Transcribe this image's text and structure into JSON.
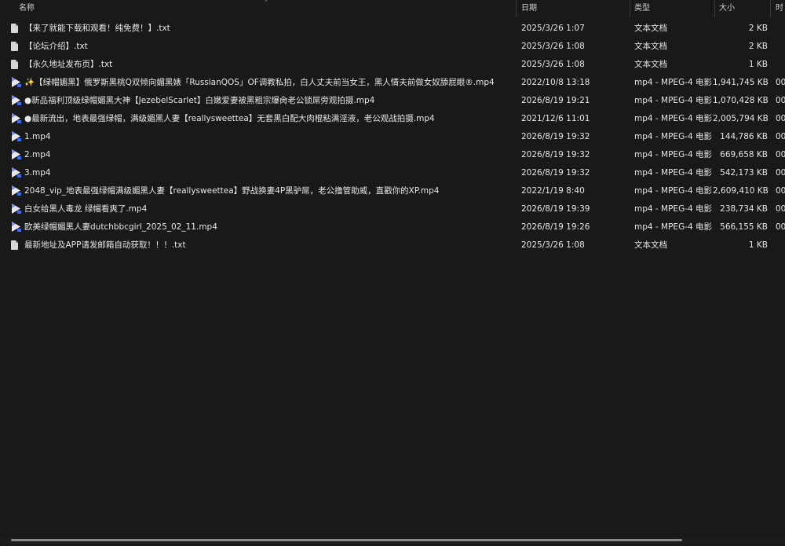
{
  "columns": {
    "name": "名称",
    "date": "日期",
    "type": "类型",
    "size": "大小",
    "extra": "时"
  },
  "files": [
    {
      "icon": "text-file-icon",
      "name": "【来了就能下载和观看！纯免费！】.txt",
      "date": "2025/3/26 1:07",
      "type": "文本文档",
      "size": "2 KB",
      "extra": ""
    },
    {
      "icon": "text-file-icon",
      "name": "【论坛介绍】.txt",
      "date": "2025/3/26 1:08",
      "type": "文本文档",
      "size": "2 KB",
      "extra": ""
    },
    {
      "icon": "text-file-icon",
      "name": "【永久地址发布页】.txt",
      "date": "2025/3/26 1:08",
      "type": "文本文档",
      "size": "1 KB",
      "extra": ""
    },
    {
      "icon": "video-file-icon",
      "name": "✨【绿帽媚黑】俄罗斯黑桃Q双倾向媚黑婊「RussianQOS」OF调教私拍，白人丈夫前当女王，黑人情夫前做女奴舔屁眼®.mp4",
      "date": "2022/10/8 13:18",
      "type": "mp4 - MPEG-4 电影...",
      "size": "1,941,745 KB",
      "extra": "00"
    },
    {
      "icon": "video-file-icon",
      "name": "●新品福利顶级绿帽媚黑大神【JezebelScarlet】白嫩爱妻被黑粗宗爆肏老公锁屌旁观拍摄.mp4",
      "date": "2026/8/19 19:21",
      "type": "mp4 - MPEG-4 电影...",
      "size": "1,070,428 KB",
      "extra": "00"
    },
    {
      "icon": "video-file-icon",
      "name": "●最新流出，地表最强绿帽，满级媚黑人妻【reallysweettea】无套黑白配大肉棍粘满淫液，老公观战拍摄.mp4",
      "date": "2021/12/6 11:01",
      "type": "mp4 - MPEG-4 电影...",
      "size": "2,005,794 KB",
      "extra": "00"
    },
    {
      "icon": "video-file-icon",
      "name": "1.mp4",
      "date": "2026/8/19 19:32",
      "type": "mp4 - MPEG-4 电影...",
      "size": "144,786 KB",
      "extra": "00"
    },
    {
      "icon": "video-file-icon",
      "name": "2.mp4",
      "date": "2026/8/19 19:32",
      "type": "mp4 - MPEG-4 电影...",
      "size": "669,658 KB",
      "extra": "00"
    },
    {
      "icon": "video-file-icon",
      "name": "3.mp4",
      "date": "2026/8/19 19:32",
      "type": "mp4 - MPEG-4 电影...",
      "size": "542,173 KB",
      "extra": "00"
    },
    {
      "icon": "video-file-icon",
      "name": "2048_vip_地表最强绿帽满级媚黑人妻【reallysweettea】野战换妻4P黑驴屌，老公撸管助威，直戳你的XP.mp4",
      "date": "2022/1/19 8:40",
      "type": "mp4 - MPEG-4 电影...",
      "size": "2,609,410 KB",
      "extra": "00"
    },
    {
      "icon": "video-file-icon",
      "name": "白女给黑人毒龙 绿帽看爽了.mp4",
      "date": "2026/8/19 19:39",
      "type": "mp4 - MPEG-4 电影...",
      "size": "238,734 KB",
      "extra": "00"
    },
    {
      "icon": "video-file-icon",
      "name": "欧美绿帽媚黑人妻dutchbbcgirl_2025_02_11.mp4",
      "date": "2026/8/19 19:26",
      "type": "mp4 - MPEG-4 电影...",
      "size": "566,155 KB",
      "extra": "00"
    },
    {
      "icon": "text-file-icon",
      "name": "最新地址及APP请发邮箱自动获取！！！.txt",
      "date": "2025/3/26 1:08",
      "type": "文本文档",
      "size": "1 KB",
      "extra": ""
    }
  ],
  "horizontal_scroll_fraction": 0.88
}
